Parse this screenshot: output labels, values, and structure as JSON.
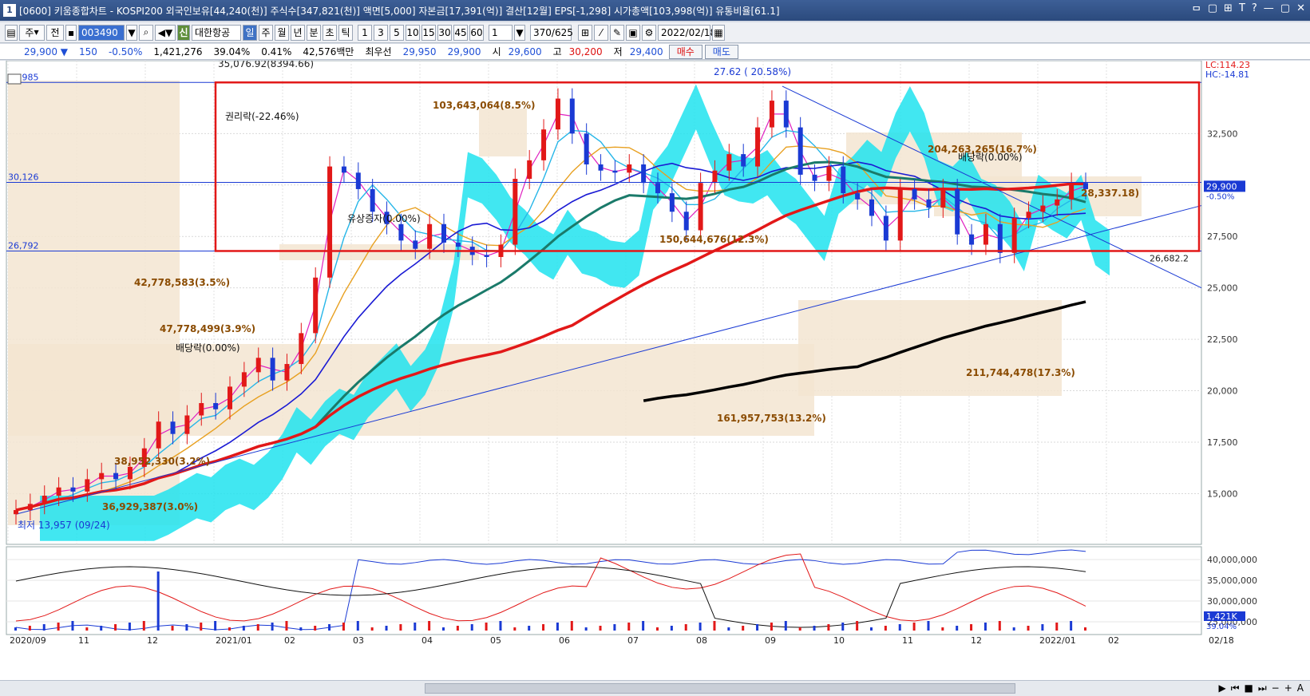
{
  "title": "[0600] 키움종합차트 - KOSPI200 외국인보유[44,240(천)] 주식수[347,821(천)] 액면[5,000] 자본금[17,391(억)] 결산[12월] EPS[-1,298] 시가총액[103,998(억)] 유통비율[61.1]",
  "window_number": "1",
  "title_buttons": [
    "ᄆ",
    "▢",
    "⊞",
    "T",
    "?",
    "—",
    "▢",
    "✕"
  ],
  "toolbar": {
    "mode": "주",
    "prev": "전",
    "code": "003490",
    "market_badge": "신",
    "stock_name": "대한항공",
    "periods": [
      "일",
      "주",
      "월",
      "년",
      "분",
      "초",
      "틱"
    ],
    "active_period": "일",
    "intervals": [
      "1",
      "3",
      "5",
      "10",
      "15",
      "30",
      "45",
      "60"
    ],
    "n_value": "1",
    "count": "370/625",
    "date": "2022/02/18"
  },
  "quote": {
    "price": "29,900 ▼",
    "change": "150",
    "change_pct": "-0.50%",
    "volume": "1,421,276",
    "vol_ratio": "39.04%",
    "turnover": "0.41%",
    "amount": "42,576백만",
    "best_label": "최우선",
    "ask": "29,950",
    "bid": "29,900",
    "open_label": "시",
    "open": "29,600",
    "high_label": "고",
    "high": "30,200",
    "low_label": "저",
    "low": "29,400",
    "buy_label": "매수",
    "sell_label": "매도"
  },
  "chart_data": {
    "type": "candlestick",
    "y_ticks": [
      "32,500",
      "30,000",
      "27,500",
      "25,000",
      "22,500",
      "20,000",
      "17,500",
      "15,000"
    ],
    "y_values": [
      32500,
      30000,
      27500,
      25000,
      22500,
      20000,
      17500,
      15000
    ],
    "ylim": [
      13000,
      35500
    ],
    "x_ticks": [
      "2020/09",
      "11",
      "12",
      "2021/01",
      "02",
      "03",
      "04",
      "05",
      "06",
      "07",
      "08",
      "09",
      "10",
      "11",
      "12",
      "2022/01",
      "02",
      "02/18"
    ],
    "h_lines": [
      {
        "label": "34,985",
        "value": 34985
      },
      {
        "label": "30,126",
        "value": 30126
      },
      {
        "label": "26,792",
        "value": 26792
      }
    ],
    "price_label": "29,900",
    "price_change_label": "-0.50%",
    "lc_label": "LC:114.23",
    "hc_label": "HC:-14.81",
    "right_level_label": "26,682.2",
    "annotations": [
      "35,076.92(8394.66)",
      "권리락(-22.46%)",
      "103,643,064(8.5%)",
      "27.62 ( 20.58%)",
      "204,263,265(16.7%)",
      "배당락(0.00%)",
      "유상증자(0.00%)",
      "28,337.18)",
      "150,644,676(12.3%)",
      "42,778,583(3.5%)",
      "47,778,499(3.9%)",
      "배당락(0.00%)",
      "211,744,478(17.3%)",
      "161,957,753(13.2%)",
      "38,952,330(3.2%)",
      "36,929,387(3.0%)",
      "최저 13,957 (09/24)"
    ],
    "sub_y_ticks": [
      "40,000,000",
      "35,000,000",
      "30,000,000",
      "25,000,000"
    ],
    "sub_last_labels": [
      "1,421K",
      "39.04%"
    ],
    "closes": [
      14200,
      14500,
      14900,
      15300,
      15100,
      15700,
      16000,
      15700,
      16300,
      17200,
      18500,
      17900,
      18800,
      19400,
      19100,
      20200,
      20900,
      21600,
      20500,
      21300,
      22800,
      25500,
      30900,
      30600,
      29800,
      28700,
      28100,
      27300,
      26900,
      28100,
      27200,
      27000,
      26600,
      26500,
      27100,
      30300,
      31200,
      32700,
      34200,
      32500,
      31000,
      30700,
      30600,
      31000,
      30100,
      29600,
      28700,
      27800,
      30100,
      30700,
      31500,
      30900,
      32800,
      34100,
      32800,
      30500,
      30200,
      30900,
      29600,
      29300,
      28500,
      27300,
      29800,
      29300,
      28900,
      29800,
      27600,
      27100,
      28100,
      26700,
      28400,
      28700,
      29000,
      29300,
      30100,
      29800
    ]
  }
}
